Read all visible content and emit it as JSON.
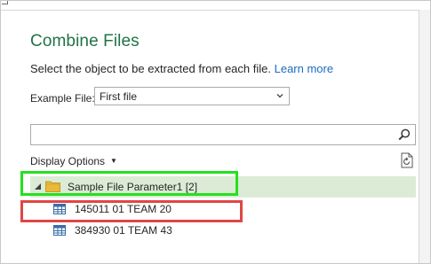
{
  "dialog": {
    "title": "Combine Files",
    "instruction": "Select the object to be extracted from each file.",
    "learn_more": "Learn more"
  },
  "example_file": {
    "label": "Example File:",
    "selected": "First file"
  },
  "search": {
    "value": "",
    "placeholder": ""
  },
  "display_options": {
    "label": "Display Options"
  },
  "tree": {
    "root": {
      "label": "Sample File Parameter1 [2]",
      "expanded": true,
      "selected": true
    },
    "children": [
      {
        "label": "145011 01 TEAM 20"
      },
      {
        "label": "384930 01 TEAM 43"
      }
    ]
  },
  "icons": {
    "expander": "expanded-triangle-icon",
    "folder": "folder-icon",
    "table": "table-icon",
    "search": "search-icon",
    "refresh": "refresh-document-icon",
    "dropdown": "chevron-down-icon"
  },
  "colors": {
    "title": "#217346",
    "link": "#1a6bc0",
    "selected_row": "#dcebd6",
    "highlight_green": "#25e01e",
    "highlight_red": "#e04646",
    "folder": "#e8b93a"
  }
}
